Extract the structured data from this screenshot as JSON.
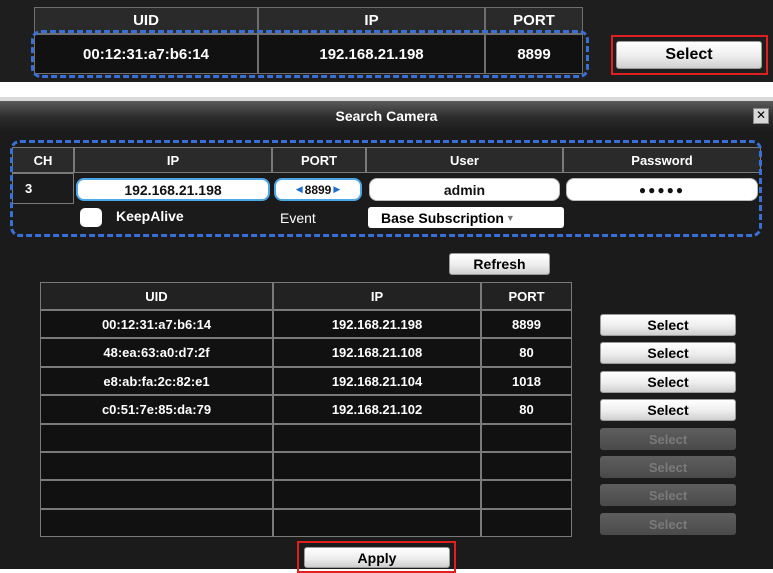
{
  "top_excerpt": {
    "headers": [
      "UID",
      "IP",
      "PORT"
    ],
    "row": [
      "00:12:31:a7:b6:14",
      "192.168.21.198",
      "8899"
    ],
    "select_label": "Select"
  },
  "dialog": {
    "title": "Search Camera",
    "close_glyph": "✕",
    "channel_headers": [
      "CH",
      "IP",
      "PORT",
      "User",
      "Password"
    ],
    "channel": {
      "ch": "3",
      "ip": "192.168.21.198",
      "port": "8899",
      "user": "admin",
      "password_mask": "●●●●●"
    },
    "keepalive_label": "KeepAlive",
    "event_label": "Event",
    "event_value": "Base Subscription",
    "refresh_label": "Refresh",
    "results_headers": [
      "UID",
      "IP",
      "PORT"
    ],
    "results": [
      {
        "uid": "00:12:31:a7:b6:14",
        "ip": "192.168.21.198",
        "port": "8899",
        "select": "Select"
      },
      {
        "uid": "48:ea:63:a0:d7:2f",
        "ip": "192.168.21.108",
        "port": "80",
        "select": "Select"
      },
      {
        "uid": "e8:ab:fa:2c:82:e1",
        "ip": "192.168.21.104",
        "port": "1018",
        "select": "Select"
      },
      {
        "uid": "c0:51:7e:85:da:79",
        "ip": "192.168.21.102",
        "port": "80",
        "select": "Select"
      },
      {
        "uid": "",
        "ip": "",
        "port": "",
        "select": "Select"
      },
      {
        "uid": "",
        "ip": "",
        "port": "",
        "select": "Select"
      },
      {
        "uid": "",
        "ip": "",
        "port": "",
        "select": "Select"
      },
      {
        "uid": "",
        "ip": "",
        "port": "",
        "select": "Select"
      }
    ],
    "apply_label": "Apply"
  },
  "colors": {
    "highlight_red": "#e02020",
    "highlight_blue": "#3a6fd6",
    "field_focus": "#4ea8e8"
  }
}
